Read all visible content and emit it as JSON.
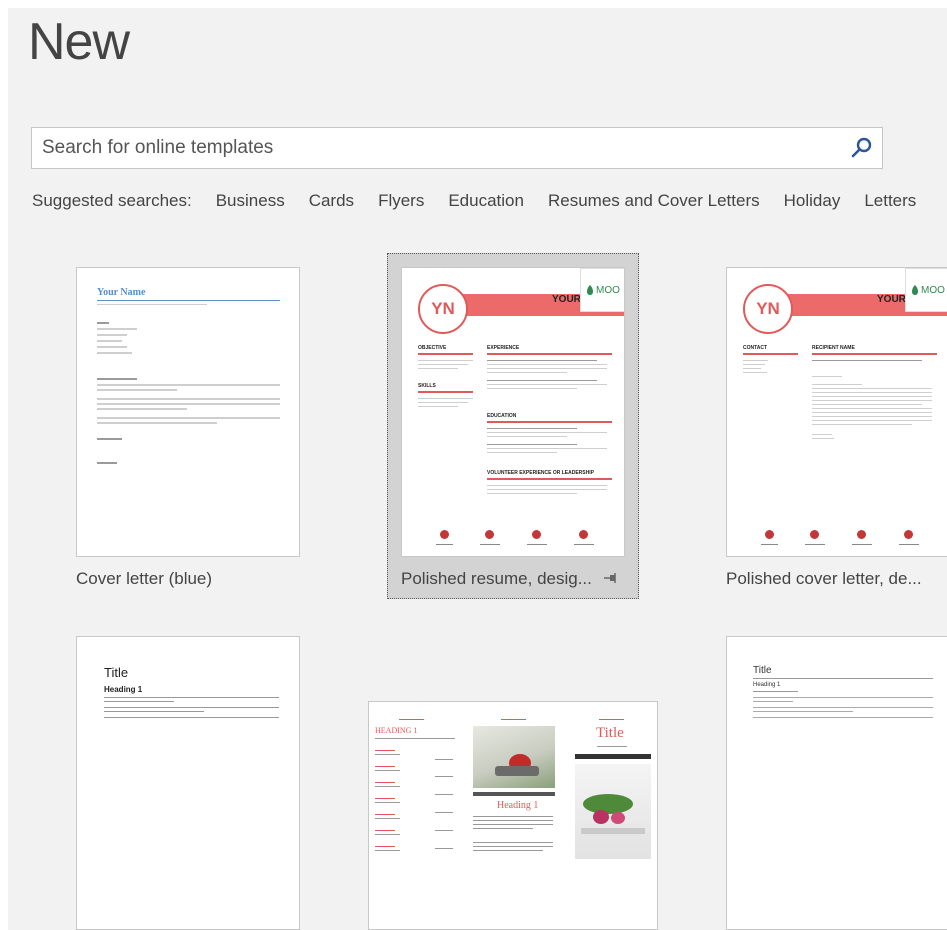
{
  "page": {
    "title": "New"
  },
  "search": {
    "placeholder": "Search for online templates"
  },
  "suggested": {
    "label": "Suggested searches:",
    "items": [
      "Business",
      "Cards",
      "Flyers",
      "Education",
      "Resumes and Cover Letters",
      "Holiday",
      "Letters"
    ]
  },
  "templates": [
    {
      "caption": "Cover letter (blue)",
      "preview_name": "Your Name"
    },
    {
      "caption": "Polished resume, desig...",
      "initials": "YN",
      "badge": "MOO",
      "header_text": "YOUR N",
      "sections": [
        "OBJECTIVE",
        "EXPERIENCE",
        "SKILLS",
        "EDUCATION",
        "VOLUNTEER EXPERIENCE OR LEADERSHIP"
      ]
    },
    {
      "caption": "Polished cover letter, de...",
      "initials": "YN",
      "badge": "MOO",
      "header_text": "YOUR N",
      "sections": [
        "CONTACT",
        "RECIPIENT NAME"
      ]
    },
    {
      "preview_title": "Title",
      "preview_heading": "Heading 1"
    },
    {
      "preview_heading_a": "HEADING 1",
      "preview_heading_b": "Heading 1",
      "preview_title": "Title"
    },
    {
      "preview_title": "Title",
      "preview_heading": "Heading 1"
    }
  ],
  "colors": {
    "accent_red": "#ec6a6a",
    "moo_green": "#2e8a4e",
    "background": "#f2f2f2"
  }
}
